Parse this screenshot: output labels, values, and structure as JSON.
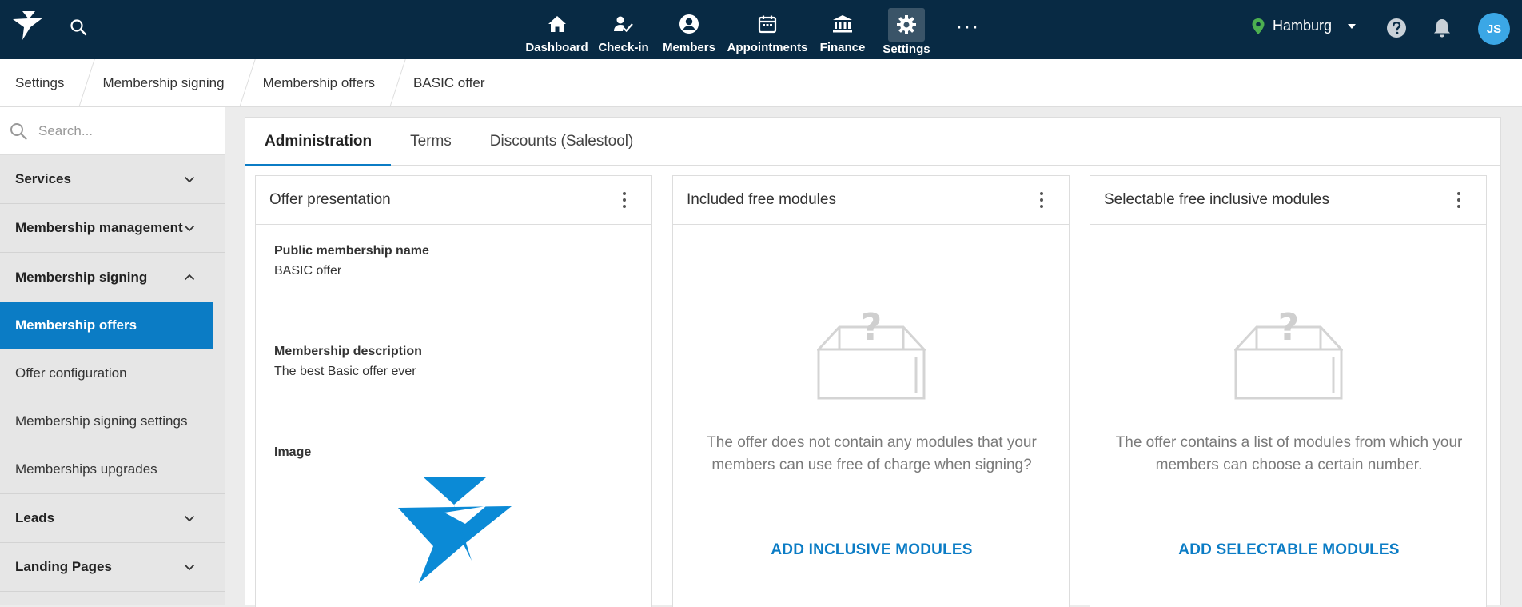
{
  "nav": {
    "items": [
      {
        "label": "Dashboard",
        "icon": "home-icon"
      },
      {
        "label": "Check-in",
        "icon": "check-in-icon"
      },
      {
        "label": "Members",
        "icon": "members-icon"
      },
      {
        "label": "Appointments",
        "icon": "calendar-icon"
      },
      {
        "label": "Finance",
        "icon": "bank-icon"
      },
      {
        "label": "Settings",
        "icon": "gear-icon"
      }
    ],
    "more_label": "···",
    "location": "Hamburg",
    "avatar_initials": "JS"
  },
  "breadcrumb": [
    "Settings",
    "Membership signing",
    "Membership offers",
    "BASIC offer"
  ],
  "sidebar": {
    "search_placeholder": "Search...",
    "groups": [
      {
        "label": "Services"
      },
      {
        "label": "Membership management"
      },
      {
        "label": "Membership signing",
        "expanded": true
      }
    ],
    "subitems": [
      {
        "label": "Membership offers"
      },
      {
        "label": "Offer configuration"
      },
      {
        "label": "Membership signing settings"
      },
      {
        "label": "Memberships upgrades"
      }
    ],
    "groups_after": [
      {
        "label": "Leads"
      },
      {
        "label": "Landing Pages"
      }
    ]
  },
  "tabs": [
    "Administration",
    "Terms",
    "Discounts (Salestool)"
  ],
  "cards": {
    "presentation": {
      "title": "Offer presentation",
      "name_label": "Public membership name",
      "name_value": "BASIC offer",
      "desc_label": "Membership description",
      "desc_value": "The best Basic offer ever",
      "image_label": "Image"
    },
    "included": {
      "title": "Included free modules",
      "empty_text": "The offer does not contain any modules that your members can use free of charge when signing?",
      "action": "ADD INCLUSIVE MODULES"
    },
    "selectable": {
      "title": "Selectable free inclusive modules",
      "empty_text": "The offer contains a list of modules from which your members can choose a certain number.",
      "action": "ADD SELECTABLE MODULES"
    }
  },
  "colors": {
    "topbar": "#082a44",
    "accent": "#0b7cc5",
    "location_pin": "#4caf50",
    "avatar": "#3ba7e6"
  }
}
